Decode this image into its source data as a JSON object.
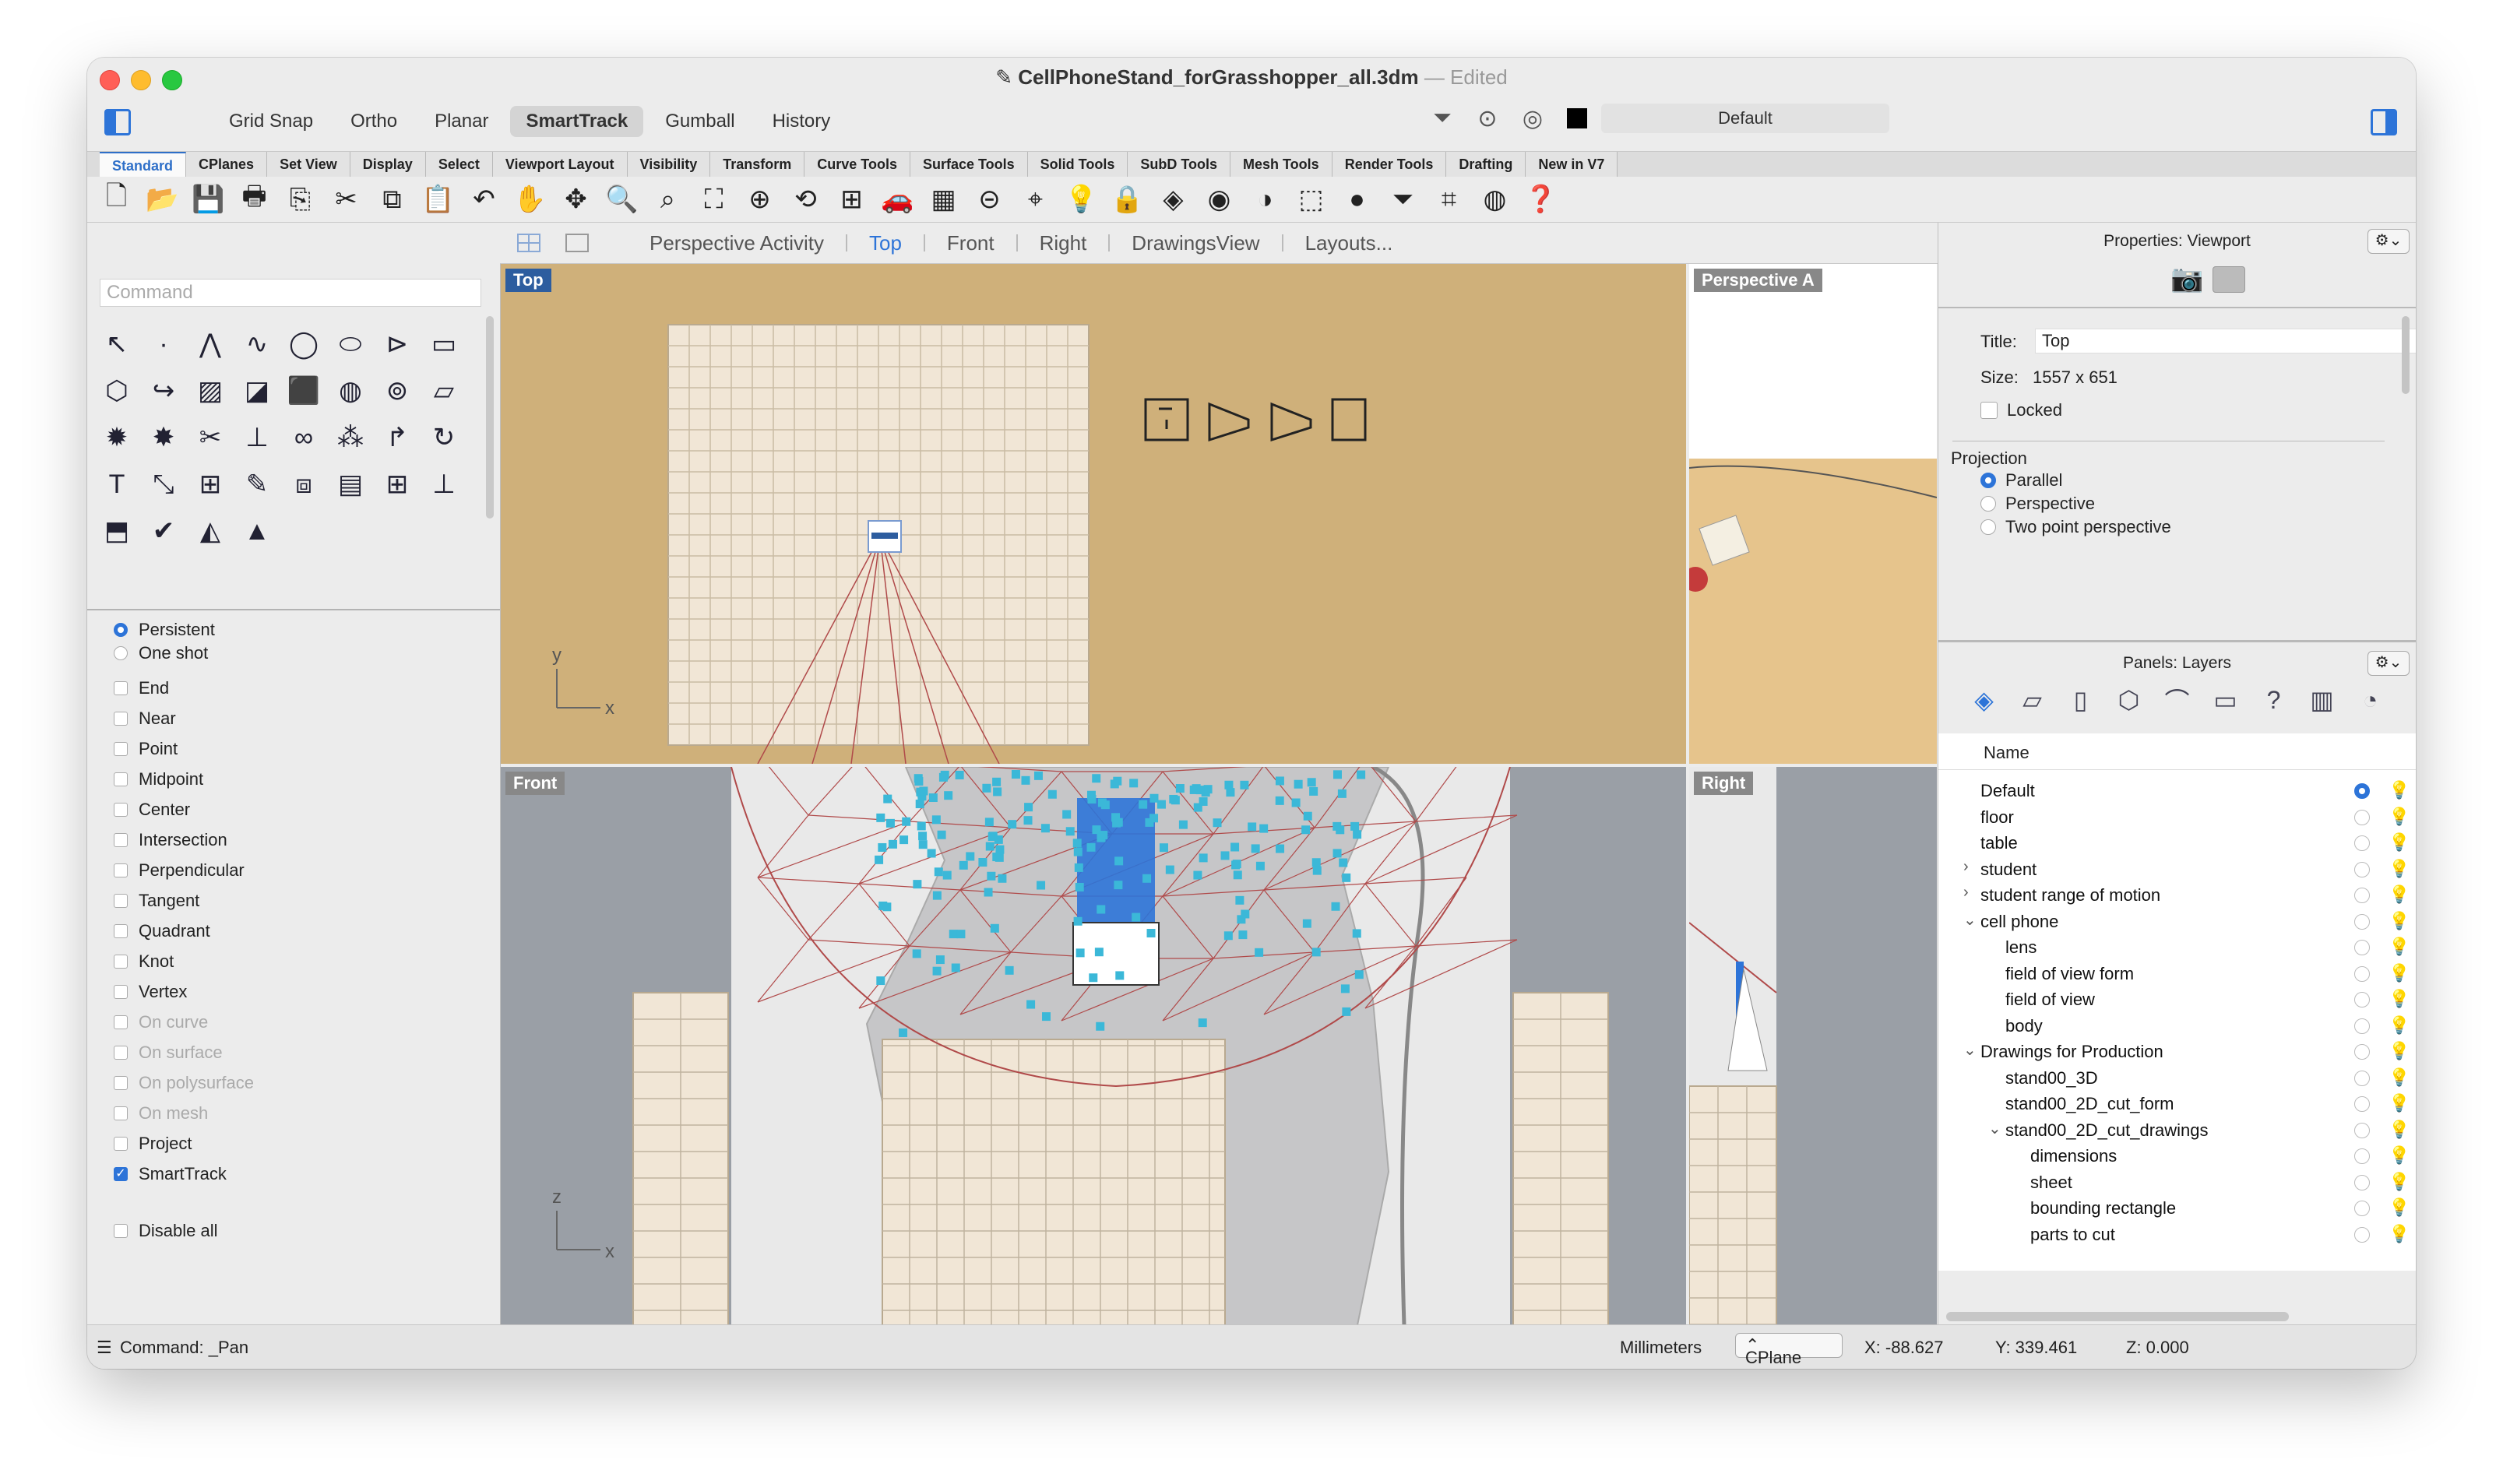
{
  "window": {
    "title": "CellPhoneStand_forGrasshopper_all.3dm",
    "title_sep": " — ",
    "edited": "Edited"
  },
  "modes": [
    "Grid Snap",
    "Ortho",
    "Planar",
    "SmartTrack",
    "Gumball",
    "History"
  ],
  "active_mode": "SmartTrack",
  "current_layer": {
    "name": "Default",
    "color": "#000000"
  },
  "tabs": [
    "Standard",
    "CPlanes",
    "Set View",
    "Display",
    "Select",
    "Viewport Layout",
    "Visibility",
    "Transform",
    "Curve Tools",
    "Surface Tools",
    "Solid Tools",
    "SubD Tools",
    "Mesh Tools",
    "Render Tools",
    "Drafting",
    "New in V7"
  ],
  "active_tab": "Standard",
  "toolbar_icons": [
    "new-icon",
    "open-icon",
    "save-icon",
    "print-icon",
    "import-icon",
    "cut-icon",
    "copy-icon",
    "paste-icon",
    "undo-icon",
    "pan-icon",
    "rotate-view-icon",
    "zoom-icon",
    "zoom-window-icon",
    "zoom-extents-icon",
    "zoom-selected-icon",
    "named-views-icon",
    "four-viewports-icon",
    "car-icon",
    "cplane-icon",
    "set-cplane-icon",
    "shaded-icon",
    "light-icon",
    "lock-icon",
    "layer-icon",
    "color-wheel-icon",
    "sphere-icon",
    "render-icon",
    "blue-sphere-icon",
    "filter-icon",
    "transform-icon",
    "grasshopper-icon",
    "help-icon"
  ],
  "command": {
    "placeholder": "Command",
    "last": "Command: _Pan"
  },
  "osnap": {
    "modes": [
      {
        "label": "Persistent",
        "on": true
      },
      {
        "label": "One shot",
        "on": false
      }
    ],
    "items": [
      {
        "label": "End",
        "checked": false,
        "enabled": true
      },
      {
        "label": "Near",
        "checked": false,
        "enabled": true
      },
      {
        "label": "Point",
        "checked": false,
        "enabled": true
      },
      {
        "label": "Midpoint",
        "checked": false,
        "enabled": true
      },
      {
        "label": "Center",
        "checked": false,
        "enabled": true
      },
      {
        "label": "Intersection",
        "checked": false,
        "enabled": true
      },
      {
        "label": "Perpendicular",
        "checked": false,
        "enabled": true
      },
      {
        "label": "Tangent",
        "checked": false,
        "enabled": true
      },
      {
        "label": "Quadrant",
        "checked": false,
        "enabled": true
      },
      {
        "label": "Knot",
        "checked": false,
        "enabled": true
      },
      {
        "label": "Vertex",
        "checked": false,
        "enabled": true
      },
      {
        "label": "On curve",
        "checked": false,
        "enabled": false
      },
      {
        "label": "On surface",
        "checked": false,
        "enabled": false
      },
      {
        "label": "On polysurface",
        "checked": false,
        "enabled": false
      },
      {
        "label": "On mesh",
        "checked": false,
        "enabled": false
      },
      {
        "label": "Project",
        "checked": false,
        "enabled": true
      },
      {
        "label": "SmartTrack",
        "checked": true,
        "enabled": true
      }
    ],
    "disable_all": "Disable all"
  },
  "viewport_tabs": [
    "Perspective Activity",
    "Top",
    "Front",
    "Right",
    "DrawingsView",
    "Layouts..."
  ],
  "active_viewport_tab": "Top",
  "viewports": {
    "top": "Top",
    "perspective": "Perspective A",
    "front": "Front",
    "right": "Right",
    "axis_x": "x",
    "axis_y": "y",
    "axis_z": "z"
  },
  "properties": {
    "header": "Properties: Viewport",
    "title_label": "Title:",
    "title_value": "Top",
    "size_label": "Size:",
    "size_value": "1557 x 651",
    "locked_label": "Locked",
    "projection_label": "Projection",
    "projections": [
      {
        "label": "Parallel",
        "on": true
      },
      {
        "label": "Perspective",
        "on": false
      },
      {
        "label": "Two point perspective",
        "on": false
      }
    ]
  },
  "layers_panel": {
    "header": "Panels: Layers",
    "name_col": "Name",
    "layers": [
      {
        "name": "Default",
        "depth": 0,
        "twisty": "",
        "current": true,
        "color": "#000000"
      },
      {
        "name": "floor",
        "depth": 0,
        "twisty": "",
        "current": false,
        "color": "#f3d3a9"
      },
      {
        "name": "table",
        "depth": 0,
        "twisty": "",
        "current": false,
        "color": "#f0ad48"
      },
      {
        "name": "student",
        "depth": 0,
        "twisty": "›",
        "current": false,
        "color": "#8a3fd0"
      },
      {
        "name": "student range of motion",
        "depth": 0,
        "twisty": "›",
        "current": false,
        "color": "#000000"
      },
      {
        "name": "cell phone",
        "depth": 0,
        "twisty": "⌄",
        "current": false,
        "color": "#000000"
      },
      {
        "name": "lens",
        "depth": 1,
        "twisty": "",
        "current": false,
        "color": "#000000"
      },
      {
        "name": "field of view form",
        "depth": 1,
        "twisty": "",
        "current": false,
        "color": "#000000"
      },
      {
        "name": "field of view",
        "depth": 1,
        "twisty": "",
        "current": false,
        "color": "#000000"
      },
      {
        "name": "body",
        "depth": 1,
        "twisty": "",
        "current": false,
        "color": "#000000"
      },
      {
        "name": "Drawings for Production",
        "depth": 0,
        "twisty": "⌄",
        "current": false,
        "color": "#000000"
      },
      {
        "name": "stand00_3D",
        "depth": 1,
        "twisty": "",
        "current": false,
        "color": "#000000"
      },
      {
        "name": "stand00_2D_cut_form",
        "depth": 1,
        "twisty": "",
        "current": false,
        "color": "#000000"
      },
      {
        "name": "stand00_2D_cut_drawings",
        "depth": 1,
        "twisty": "⌄",
        "current": false,
        "color": "#000000"
      },
      {
        "name": "dimensions",
        "depth": 2,
        "twisty": "",
        "current": false,
        "color": "#000000"
      },
      {
        "name": "sheet",
        "depth": 2,
        "twisty": "",
        "current": false,
        "color": "#e93ee2"
      },
      {
        "name": "bounding rectangle",
        "depth": 2,
        "twisty": "",
        "current": false,
        "color": "#f0ad48"
      },
      {
        "name": "parts to cut",
        "depth": 2,
        "twisty": "",
        "current": false,
        "color": "#000000"
      }
    ]
  },
  "status": {
    "units": "Millimeters",
    "cplane": "CPlane",
    "x": "X: -88.627",
    "y": "Y: 339.461",
    "z": "Z: 0.000"
  },
  "colors": {
    "accent": "#2d74d8",
    "floor": "#cfb07a",
    "grid_bg": "#f1e6d6",
    "viewport_gray": "#9a9fa6",
    "field_of_view": "#b04a4a",
    "points": "#3bb8d8"
  }
}
